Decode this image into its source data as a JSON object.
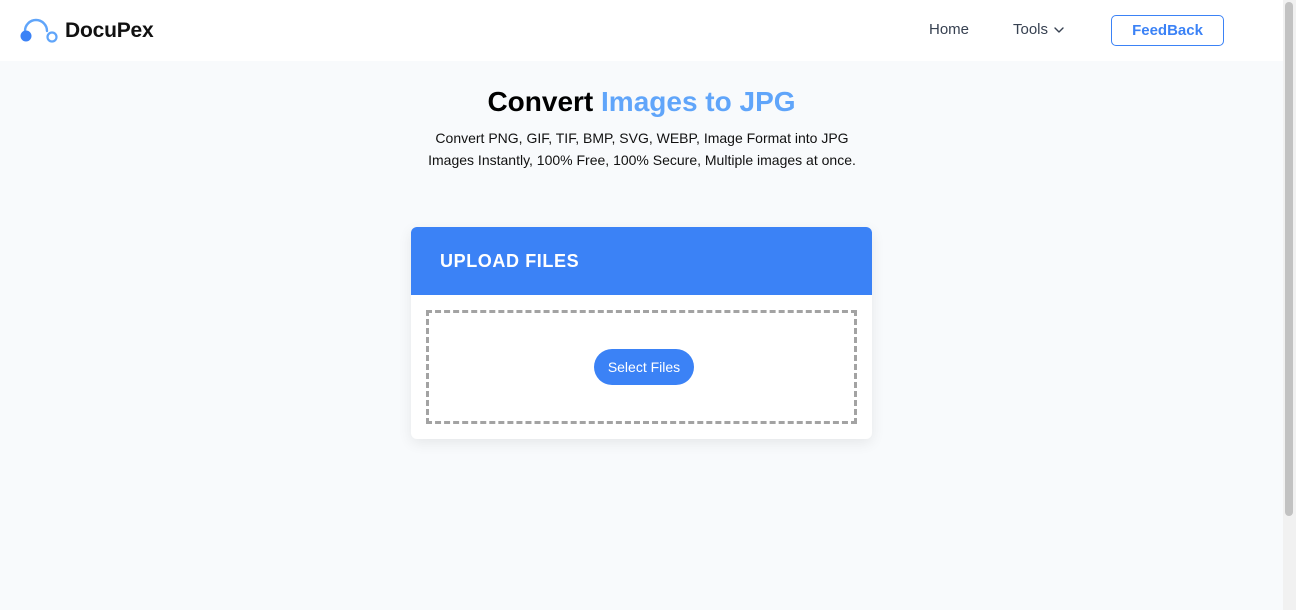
{
  "header": {
    "logo_text": "DocuPex",
    "nav": {
      "home": "Home",
      "tools": "Tools"
    },
    "feedback_label": "FeedBack"
  },
  "hero": {
    "title_prefix": "Convert",
    "title_accent": "Images to JPG",
    "subtitle": "Convert PNG, GIF, TIF, BMP, SVG, WEBP, Image Format into JPG Images Instantly, 100% Free, 100% Secure, Multiple images at once."
  },
  "upload": {
    "title": "UPLOAD FILES",
    "select_label": "Select Files"
  },
  "colors": {
    "accent": "#3b82f6",
    "accent_light": "#60a5fa",
    "background": "#f8fafc"
  },
  "icons": {
    "logo": "docupex-logo-icon",
    "tools_dropdown": "chevron-down-icon"
  }
}
